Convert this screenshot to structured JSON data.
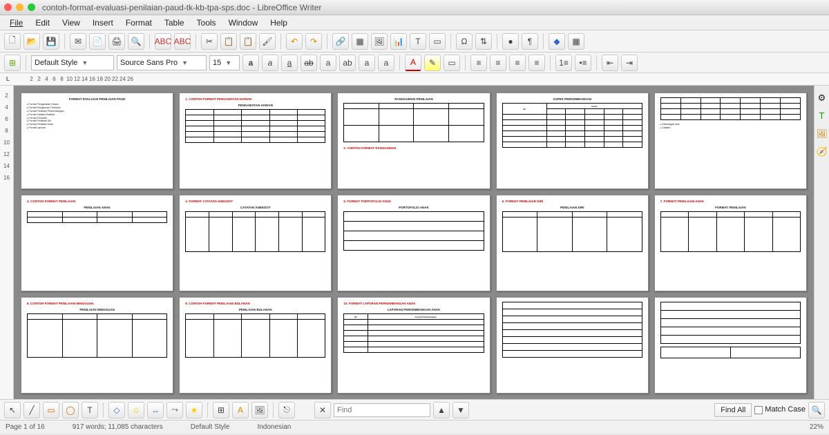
{
  "window": {
    "title": "contoh-format-evaluasi-penilaian-paud-tk-kb-tpa-sps.doc - LibreOffice Writer"
  },
  "menu": {
    "items": [
      "File",
      "Edit",
      "View",
      "Insert",
      "Format",
      "Table",
      "Tools",
      "Window",
      "Help"
    ]
  },
  "format": {
    "style_label": "Default Style",
    "font_label": "Source Sans Pro",
    "size_label": "15"
  },
  "ruler": {
    "marks": [
      "2",
      "2",
      "4",
      "6",
      "8",
      "10",
      "12",
      "14",
      "16",
      "18",
      "20",
      "22",
      "24",
      "26"
    ]
  },
  "vruler": {
    "marks": [
      "2",
      "4",
      "6",
      "8",
      "10",
      "12",
      "14",
      "16"
    ]
  },
  "search": {
    "placeholder": "Find",
    "findall": "Find All",
    "matchcase": "Match Case"
  },
  "status": {
    "page": "Page 1 of 16",
    "words": "917 words; 11,085 characters",
    "style": "Default Style",
    "lang": "Indonesian",
    "zoom": "22%"
  },
  "icons": {
    "new": "🗋",
    "open": "📂",
    "save": "💾",
    "mail": "✉",
    "pdf": "📄",
    "print": "🖨",
    "preview": "🔍",
    "cut": "✂",
    "copy": "📋",
    "paste": "📋",
    "brush": "🖌",
    "undo": "↶",
    "redo": "↷",
    "link": "🔗",
    "table": "▦",
    "image": "🖼",
    "chart": "📊",
    "text": "T",
    "frame": "▭",
    "char": "Ω",
    "sort": "⇅",
    "nonprint": "¶",
    "record": "●",
    "diamond": "◆",
    "grid": "▦",
    "bold": "a",
    "italic": "a",
    "underline": "a",
    "strike": "ab",
    "sup": "a",
    "sub": "ab",
    "super": "a",
    "a": "a",
    "hilite": "▮",
    "fontcolor": "A",
    "left": "≡",
    "center": "≡",
    "right": "≡",
    "just": "≡",
    "num": "1.",
    "bul": "•",
    "indent_dec": "⇤",
    "indent_inc": "⇥",
    "nav": "🧭",
    "gal": "🖼",
    "clip": "📎",
    "src": "📋",
    "cursor": "↖",
    "pen": "✎",
    "rect": "▭",
    "ell": "◯",
    "txt": "T",
    "diam": "◇",
    "smile": "☺",
    "arrow": "↔",
    "conn": "⤳",
    "star": "★",
    "crop": "⊞",
    "img": "🖼",
    "ext": "⎋"
  },
  "pages_red": {
    "p2": "1. CONTOH FORMAT PENGAMATAN HARIAN",
    "p4": "2. CONTOH FORMAT RANGKUMAN",
    "p6": "3. CONTOH FORMAT PENILAIAN",
    "p7": "4. FORMAT CATATAN ANEKDOT",
    "p8": "5. FORMAT PORTOFOLIO ANAK",
    "p9": "6. FORMAT PENILAIAN DIRI",
    "p10": "7. FORMAT PENILAIAN ANAK",
    "p11": "8. CONTOH FORMAT PENILAIAN MINGGUAN",
    "p12": "9. CONTOH FORMAT PENILAIAN BULANAN",
    "p13": "10. FORMAT LAPORAN PERKEMBANGAN ANAK"
  }
}
